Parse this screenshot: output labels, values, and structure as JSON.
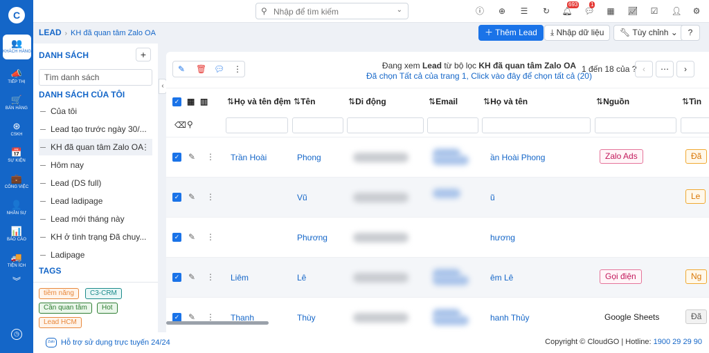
{
  "rail": {
    "logo": "C",
    "items": [
      {
        "icon": "👥",
        "label": "KHÁCH HÀNG",
        "active": true
      },
      {
        "icon": "📣",
        "label": "TIẾP THỊ"
      },
      {
        "icon": "🛒",
        "label": "BÁN HÀNG"
      },
      {
        "icon": "⊛",
        "label": "CSKH"
      },
      {
        "icon": "📅",
        "label": "SỰ KIỆN"
      },
      {
        "icon": "💼",
        "label": "CÔNG VIỆC"
      },
      {
        "icon": "👤",
        "label": "NHÂN SỰ"
      },
      {
        "icon": "📊",
        "label": "BÁO CÁO"
      },
      {
        "icon": "🚚",
        "label": "TIỆN ÍCH"
      }
    ],
    "more_icon": "double-chevron-down-icon",
    "bottom_icon": "clock-icon"
  },
  "topbar": {
    "search_placeholder": "Nhập để tìm kiếm",
    "notification_count": "693",
    "chat_count": "1"
  },
  "breadcrumb": {
    "root": "LEAD",
    "current": "KH đã quan tâm Zalo OA"
  },
  "actions": {
    "add": "Thêm Lead",
    "import": "Nhập dữ liệu",
    "customize": "Tùy chỉnh"
  },
  "lists": {
    "title": "DANH SÁCH",
    "search_placeholder": "Tìm danh sách",
    "my_lists_title": "DANH SÁCH CỦA TÔI",
    "items": [
      "Của tôi",
      "Lead tạo trước ngày 30/...",
      "KH đã quan tâm Zalo OA",
      "Hôm nay",
      "Lead (DS full)",
      "Lead ladipage",
      "Lead mới tháng này",
      "KH ở tình trạng Đã chuy...",
      "Ladipage"
    ],
    "active_index": 2,
    "tags_title": "TAGS",
    "tags": [
      {
        "label": "tiềm năng",
        "color": "#e8873a",
        "bg": "#fff4ea"
      },
      {
        "label": "C3-CRM",
        "color": "#1a8a8a",
        "bg": "#e8f7f7"
      },
      {
        "label": "Cần quan tâm",
        "color": "#2e7d32",
        "bg": "#eaf6ea"
      },
      {
        "label": "Hot",
        "color": "#2e7d32",
        "bg": "#eaf6ea"
      },
      {
        "label": "Lead HCM",
        "color": "#e8873a",
        "bg": "#fff4ea"
      }
    ]
  },
  "table": {
    "info_prefix": "Đang xem",
    "info_module": "Lead",
    "info_mid": "từ bộ lọc",
    "info_filter": "KH đã quan tâm Zalo OA",
    "select_all_text": "Đã chọn Tất cả của trang 1, Click vào đây để chọn tất cả (20)",
    "pager_text": "1 đến 18 của ?",
    "columns": [
      "Họ và tên đệm",
      "Tên",
      "Di động",
      "Email",
      "Họ và tên",
      "Nguồn",
      "Tìn"
    ],
    "rows": [
      {
        "middle": "Trần Hoài",
        "first": "Phong",
        "full": "ần Hoài Phong",
        "source": "Zalo Ads",
        "source_style": "pink",
        "status": "Đã"
      },
      {
        "middle": "",
        "first": "Vũ",
        "full": "ũ",
        "source": "",
        "source_style": "",
        "status": "Le"
      },
      {
        "middle": "",
        "first": "Phương",
        "full": "hương",
        "source": "",
        "source_style": "",
        "status": ""
      },
      {
        "middle": "Liêm",
        "first": "Lê",
        "full": "êm Lê",
        "source": "Gọi điện",
        "source_style": "pink",
        "status": "Ng"
      },
      {
        "middle": "Thanh",
        "first": "Thùy",
        "full": "hanh Thủy",
        "source": "Google Sheets",
        "source_style": "plain",
        "status": "Đã"
      }
    ]
  },
  "footer": {
    "help": "Hỗ trợ sử dụng trực tuyến 24/24",
    "copyright": "Copyright © CloudGO | Hotline: ",
    "hotline": "1900 29 29 90"
  }
}
